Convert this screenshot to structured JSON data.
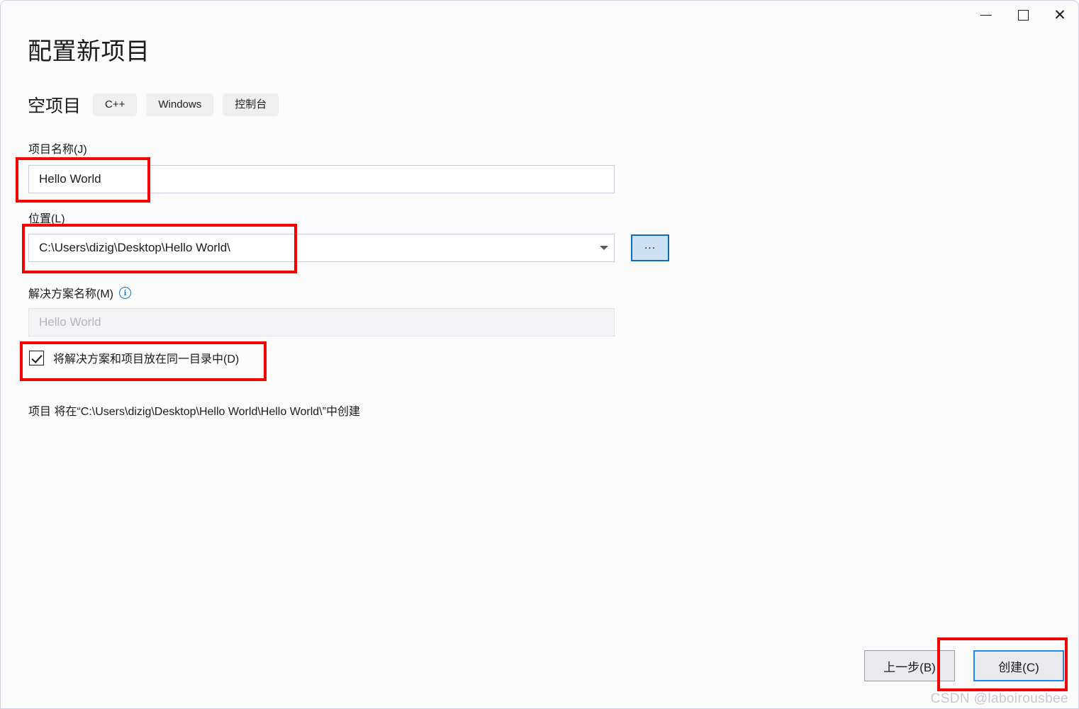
{
  "window": {
    "controls": {
      "minimize_label": "Minimize",
      "maximize_label": "Maximize",
      "close_glyph": "✕"
    }
  },
  "header": {
    "title": "配置新项目",
    "template_name": "空项目",
    "tags": [
      "C++",
      "Windows",
      "控制台"
    ]
  },
  "form": {
    "project_name": {
      "label": "项目名称(J)",
      "value": "Hello World"
    },
    "location": {
      "label": "位置(L)",
      "value": "C:\\Users\\dizig\\Desktop\\Hello World\\",
      "browse_button_label": "...",
      "dropdown_icon": "chevron-down-icon"
    },
    "solution_name": {
      "label": "解决方案名称(M)",
      "info_icon": "info-icon",
      "info_glyph": "i",
      "placeholder": "Hello World",
      "value": "",
      "disabled": true
    },
    "same_directory_checkbox": {
      "label": "将解决方案和项目放在同一目录中(D)",
      "checked": true
    },
    "description": "项目 将在“C:\\Users\\dizig\\Desktop\\Hello World\\Hello World\\”中创建"
  },
  "footer": {
    "back_label": "上一步(B)",
    "create_label": "创建(C)"
  },
  "watermark": "CSDN @laboirousbee",
  "colors": {
    "accent_blue": "#0f6cbd",
    "focus_blue": "#1a8cf0",
    "annotation_red": "#f50000",
    "info_blue": "#1a78b5",
    "window_bg": "#fbfbfc",
    "tag_bg": "#efefef"
  }
}
